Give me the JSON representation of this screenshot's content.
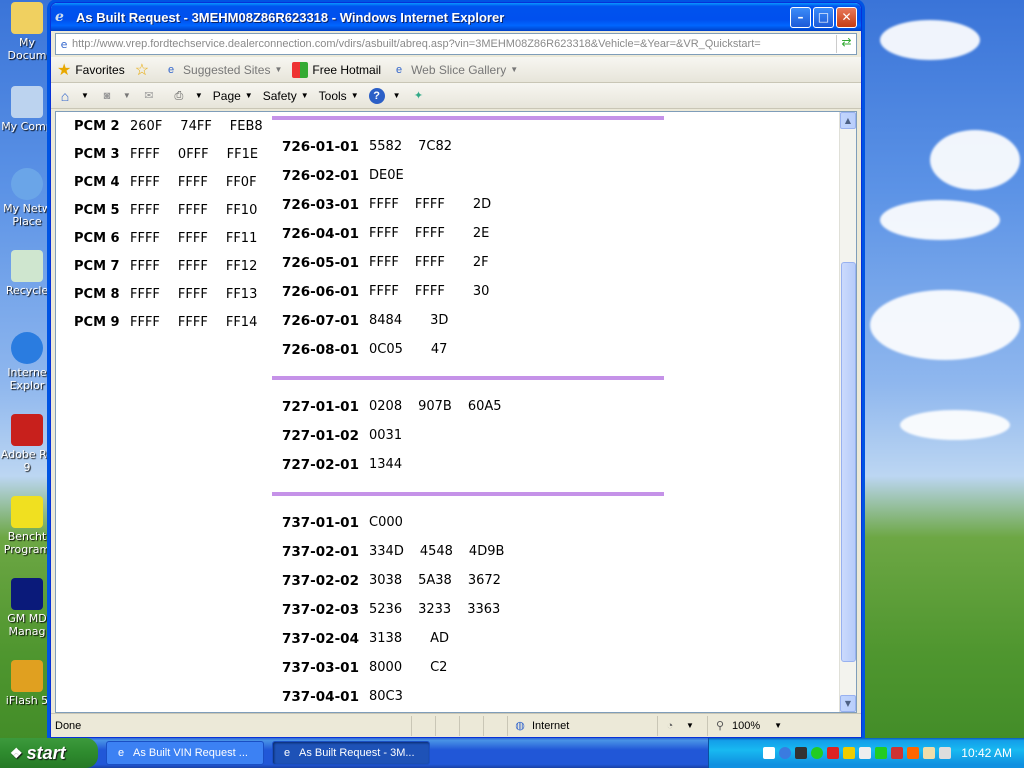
{
  "window": {
    "title": "As Built Request - 3MEHM08Z86R623318 - Windows Internet Explorer",
    "address": "http://www.vrep.fordtechservice.dealerconnection.com/vdirs/asbuilt/abreq.asp?vin=3MEHM08Z86R623318&Vehicle=&Year=&VR_Quickstart="
  },
  "favorites_bar": {
    "favorites": "Favorites",
    "suggested_sites": "Suggested Sites",
    "free_hotmail": "Free Hotmail",
    "web_slice_gallery": "Web Slice Gallery"
  },
  "command_bar": {
    "page": "Page",
    "safety": "Safety",
    "tools": "Tools"
  },
  "pcm_rows": [
    {
      "label": "PCM 2",
      "v1": "260F",
      "v2": "74FF",
      "v3": "FEB8"
    },
    {
      "label": "PCM 3",
      "v1": "FFFF",
      "v2": "0FFF",
      "v3": "FF1E"
    },
    {
      "label": "PCM 4",
      "v1": "FFFF",
      "v2": "FFFF",
      "v3": "FF0F"
    },
    {
      "label": "PCM 5",
      "v1": "FFFF",
      "v2": "FFFF",
      "v3": "FF10"
    },
    {
      "label": "PCM 6",
      "v1": "FFFF",
      "v2": "FFFF",
      "v3": "FF11"
    },
    {
      "label": "PCM 7",
      "v1": "FFFF",
      "v2": "FFFF",
      "v3": "FF12"
    },
    {
      "label": "PCM 8",
      "v1": "FFFF",
      "v2": "FFFF",
      "v3": "FF13"
    },
    {
      "label": "PCM 9",
      "v1": "FFFF",
      "v2": "FFFF",
      "v3": "FF14"
    }
  ],
  "sections": [
    {
      "rows": [
        {
          "code": "726-01-01",
          "vals": [
            "5582",
            "7C82"
          ]
        },
        {
          "code": "726-02-01",
          "vals": [
            "DE0E"
          ]
        },
        {
          "code": "726-03-01",
          "vals": [
            "FFFF",
            "FFFF",
            "2D"
          ]
        },
        {
          "code": "726-04-01",
          "vals": [
            "FFFF",
            "FFFF",
            "2E"
          ]
        },
        {
          "code": "726-05-01",
          "vals": [
            "FFFF",
            "FFFF",
            "2F"
          ]
        },
        {
          "code": "726-06-01",
          "vals": [
            "FFFF",
            "FFFF",
            "30"
          ]
        },
        {
          "code": "726-07-01",
          "vals": [
            "8484",
            "3D"
          ]
        },
        {
          "code": "726-08-01",
          "vals": [
            "0C05",
            "47"
          ]
        }
      ]
    },
    {
      "rows": [
        {
          "code": "727-01-01",
          "vals": [
            "0208",
            "907B",
            "60A5"
          ]
        },
        {
          "code": "727-01-02",
          "vals": [
            "0031"
          ]
        },
        {
          "code": "727-02-01",
          "vals": [
            "1344"
          ]
        }
      ]
    },
    {
      "rows": [
        {
          "code": "737-01-01",
          "vals": [
            "C000"
          ]
        },
        {
          "code": "737-02-01",
          "vals": [
            "334D",
            "4548",
            "4D9B"
          ]
        },
        {
          "code": "737-02-02",
          "vals": [
            "3038",
            "5A38",
            "3672"
          ]
        },
        {
          "code": "737-02-03",
          "vals": [
            "5236",
            "3233",
            "3363"
          ]
        },
        {
          "code": "737-02-04",
          "vals": [
            "3138",
            "AD"
          ]
        },
        {
          "code": "737-03-01",
          "vals": [
            "8000",
            "C2"
          ]
        },
        {
          "code": "737-04-01",
          "vals": [
            "80C3"
          ]
        }
      ]
    }
  ],
  "status": {
    "left": "Done",
    "zone": "Internet",
    "zoom": "100%"
  },
  "taskbar": {
    "start": "start",
    "tasks": [
      "As Built VIN Request ...",
      "As Built Request - 3M..."
    ],
    "clock": "10:42 AM"
  },
  "desktop_icons": [
    "My Docum",
    "My Comp",
    "My Netw Place",
    "Recycle",
    "Interne Explor",
    "Adobe Re 9",
    "Bencht Program",
    "GM MD Manag",
    "iFlash 5"
  ],
  "colors": {
    "divider": "#c592e8",
    "titlebar": "#0053ee"
  }
}
